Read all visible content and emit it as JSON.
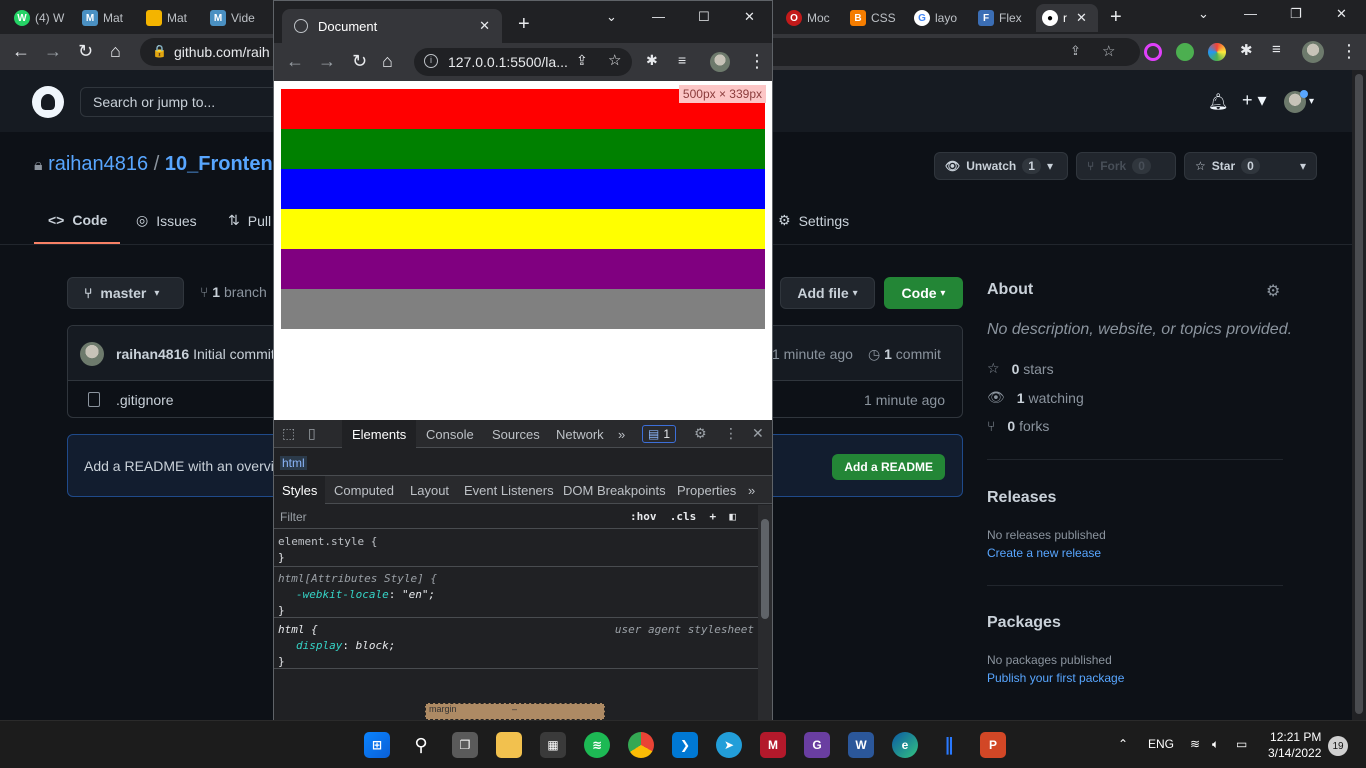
{
  "browser": {
    "tabs": [
      {
        "label": "(4) W",
        "icon": "whatsapp-icon",
        "color": "#25d366",
        "glyph": "W"
      },
      {
        "label": "Mat",
        "icon": "m-app-icon",
        "color": "#4a90c2",
        "glyph": "M"
      },
      {
        "label": "Mat",
        "icon": "slides-icon",
        "color": "#f4b400",
        "glyph": "▭"
      },
      {
        "label": "Vide",
        "icon": "m-app-icon",
        "color": "#4a90c2",
        "glyph": "M"
      }
    ],
    "right_tabs": [
      {
        "label": "Moc",
        "icon": "opera-icon",
        "color": "#c21a1a",
        "glyph": "O"
      },
      {
        "label": "CSS",
        "icon": "blogger-icon",
        "color": "#f57d00",
        "glyph": "B"
      },
      {
        "label": "layo",
        "icon": "google-icon",
        "color": "#ffffff",
        "glyph": "G"
      },
      {
        "label": "Flex",
        "icon": "flexbox-icon",
        "color": "#3b6eb5",
        "glyph": "F"
      },
      {
        "label": "r",
        "icon": "github-icon",
        "color": "#ffffff",
        "glyph": "●",
        "active": true
      }
    ],
    "address": "github.com/raih"
  },
  "github": {
    "search_placeholder": "Search or jump to...",
    "owner": "raihan4816",
    "repo": "10_Frontenc",
    "unwatch_label": "Unwatch",
    "unwatch_count": "1",
    "fork_label": "Fork",
    "fork_count": "0",
    "star_label": "Star",
    "star_count": "0",
    "nav": {
      "code": "Code",
      "issues": "Issues",
      "pulls": "Pull",
      "settings": "Settings"
    },
    "branch": "master",
    "branch_count": "1",
    "branch_word": "branch",
    "add_file": "Add file",
    "code_btn": "Code",
    "commit": {
      "user": "raihan4816",
      "message": "Initial commit",
      "ago": "1 minute ago",
      "count": "1",
      "count_word": "commit"
    },
    "files": [
      {
        "name": ".gitignore",
        "ago": "1 minute ago"
      }
    ],
    "readme_prompt": "Add a README with an overvie",
    "readme_button": "Add a README",
    "about": {
      "heading": "About",
      "description": "No description, website, or topics provided.",
      "stars_count": "0",
      "stars_word": "stars",
      "watching_count": "1",
      "watching_word": "watching",
      "forks_count": "0",
      "forks_word": "forks"
    },
    "releases": {
      "heading": "Releases",
      "empty": "No releases published",
      "link": "Create a new release"
    },
    "packages": {
      "heading": "Packages",
      "empty": "No packages published",
      "link": "Publish your first package"
    }
  },
  "popup": {
    "tab_title": "Document",
    "url": "127.0.0.1:5500/la...",
    "size_badge": "500px × 339px",
    "bars": [
      "#ff0000",
      "#008000",
      "#0000ff",
      "#ffff00",
      "#800080",
      "#808080"
    ]
  },
  "devtools": {
    "tabs": [
      "Elements",
      "Console",
      "Sources",
      "Network"
    ],
    "more": "»",
    "issues_count": "1",
    "breadcrumb": "html",
    "subtabs": [
      "Styles",
      "Computed",
      "Layout",
      "Event Listeners",
      "DOM Breakpoints",
      "Properties"
    ],
    "filter_placeholder": "Filter",
    "hov": ":hov",
    "cls": ".cls",
    "rule1_selector": "element.style {",
    "rule2_selector": "html[Attributes Style] {",
    "rule2_prop": "-webkit-locale",
    "rule2_value": "\"en\";",
    "rule3_selector": "html {",
    "rule3_source": "user agent stylesheet",
    "rule3_prop": "display",
    "rule3_value": "block;",
    "close_brace": "}",
    "margin_label": "margin",
    "margin_value": "–"
  },
  "taskbar": {
    "lang": "ENG",
    "time": "12:21 PM",
    "date": "3/14/2022",
    "notifications": "19"
  }
}
